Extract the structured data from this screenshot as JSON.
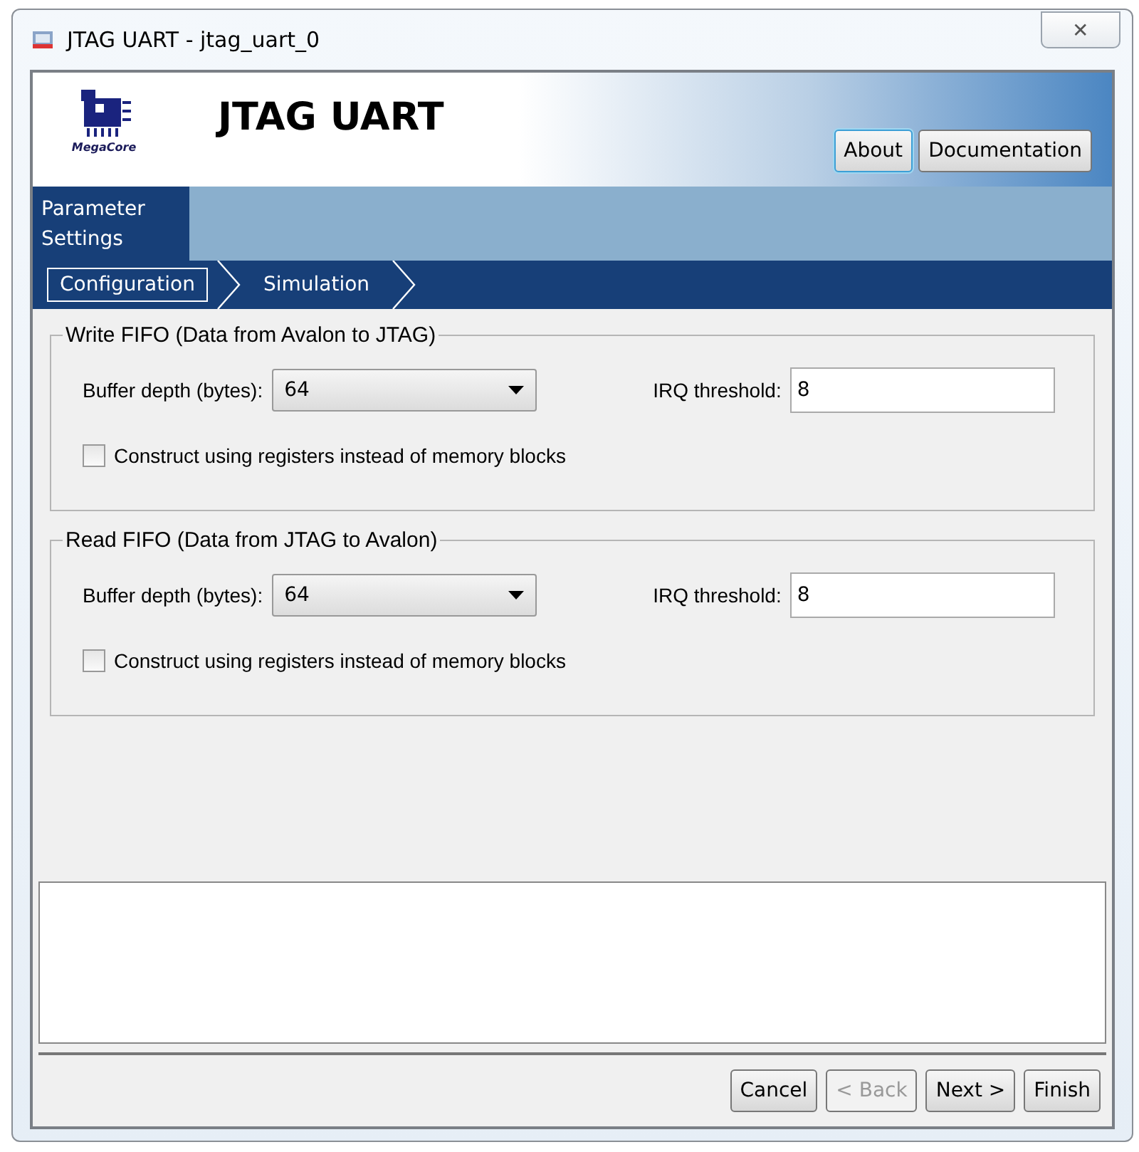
{
  "window": {
    "title": "JTAG UART - jtag_uart_0",
    "close": "✕"
  },
  "header": {
    "logo_text": "MegaCore",
    "title": "JTAG UART",
    "buttons": [
      {
        "label": "About",
        "focused": true
      },
      {
        "label": "Documentation",
        "focused": false
      }
    ]
  },
  "tabs": [
    {
      "label": "Parameter Settings",
      "selected": true
    }
  ],
  "steps": [
    {
      "label": "Configuration",
      "selected": true
    },
    {
      "label": "Simulation",
      "selected": false
    }
  ],
  "groups": [
    {
      "title": "Write FIFO (Data from Avalon to JTAG)",
      "depth_label": "Buffer depth (bytes):",
      "depth": "64",
      "irq_label": "IRQ threshold:",
      "irq": "8",
      "checkbox": {
        "label": "Construct using registers instead of memory blocks",
        "checked": false
      }
    },
    {
      "title": "Read FIFO (Data from JTAG to Avalon)",
      "depth_label": "Buffer depth (bytes):",
      "depth": "64",
      "irq_label": "IRQ threshold:",
      "irq": "8",
      "checkbox": {
        "label": "Construct using registers instead of memory blocks",
        "checked": false
      }
    }
  ],
  "footer_buttons": [
    {
      "label": "Cancel",
      "disabled": false
    },
    {
      "label": "< Back",
      "disabled": true
    },
    {
      "label": "Next >",
      "disabled": false
    },
    {
      "label": "Finish",
      "disabled": false
    }
  ]
}
